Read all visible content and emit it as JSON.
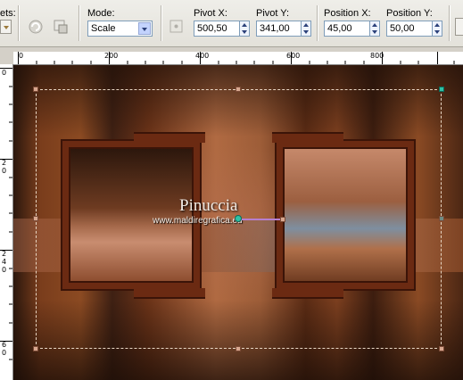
{
  "toolbar": {
    "presets_label": "ets:",
    "mode_label": "Mode:",
    "mode_value": "Scale",
    "pivot_x_label": "Pivot X:",
    "pivot_x_value": "500,50",
    "pivot_y_label": "Pivot Y:",
    "pivot_y_value": "341,00",
    "position_x_label": "Position X:",
    "position_x_value": "45,00",
    "position_y_label": "Position Y:",
    "position_y_value": "50,00"
  },
  "ruler": {
    "h_marks": [
      "0",
      "200",
      "400",
      "600",
      "800"
    ],
    "v_marks": [
      "0",
      "2",
      "0",
      "2",
      "4",
      "0",
      "6",
      "0"
    ]
  },
  "watermark": {
    "title": "Pinuccia",
    "subtitle": "www.maldiregrafica.eu"
  },
  "colors": {
    "frame": "#6b2a12",
    "pivot": "#2fc2a6",
    "handle": "#d8a78f"
  }
}
